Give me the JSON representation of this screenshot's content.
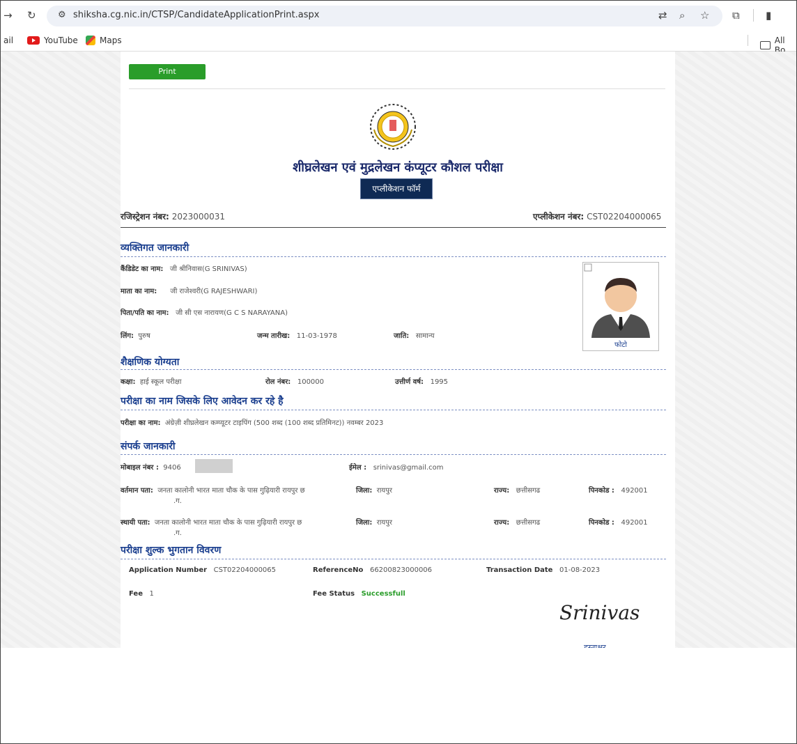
{
  "browser": {
    "url": "shiksha.cg.nic.in/CTSP/CandidateApplicationPrint.aspx",
    "bookmarks": [
      "ail",
      "YouTube",
      "Maps"
    ],
    "all_bookmarks": "All Bo"
  },
  "page": {
    "print_label": "Print",
    "title": "शीघ्रलेखन एवं मुद्रलेखन कंप्यूटर कौशल परीक्षा",
    "badge": "एप्लीकेशन फॉर्म",
    "registration_label": "रजिस्ट्रेशन नंबर:",
    "registration_value": "2023000031",
    "application_label": "एप्लीकेशन नंबर:",
    "application_value": "CST02204000065"
  },
  "personal": {
    "heading": "व्यक्तिगत जानकारी",
    "candidate_label": "कैंडिडेट का नाम:",
    "candidate_value": "जी श्रीनिवास(G SRINIVAS)",
    "mother_label": "माता का नाम:",
    "mother_value": "जी राजेश्वरी(G RAJESHWARI)",
    "father_label": "पिता/पति का नाम:",
    "father_value": "जी सी एस नारायण(G C S NARAYANA)",
    "gender_label": "लिंग:",
    "gender_value": "पुरुष",
    "dob_label": "जन्म तारीख:",
    "dob_value": "11-03-1978",
    "caste_label": "जाति:",
    "caste_value": "सामान्य",
    "photo_caption": "फोटो"
  },
  "education": {
    "heading": "शैक्षणिक योग्यता",
    "class_label": "कक्षा:",
    "class_value": "हाई स्कूल परीक्षा",
    "roll_label": "रोल नंबर:",
    "roll_value": "100000",
    "year_label": "उत्तीर्ण वर्ष:",
    "year_value": "1995"
  },
  "exam": {
    "heading": "परीक्षा का नाम जिसके लिए आवेदन कर रहे है",
    "name_label": "परीक्षा का नाम:",
    "name_value": "अंग्रेज़ी शीघ्रलेखन कम्प्यूटर टाइपिंग (500 शब्द (100 शब्द प्रतिमिनट)) नवम्बर 2023"
  },
  "contact": {
    "heading": "संपर्क जानकारी",
    "mobile_label": "मोबाइल नंबर :",
    "mobile_value": "9406",
    "email_label": "ईमेल :",
    "email_value": "srinivas@gmail.com",
    "current_label": "वर्तमान पता:",
    "current_line1": "जनता कालोनी भारत माता चौक के पास गुढ़ियारी रायपुर छ",
    "current_line2": ".ग.",
    "district_label": "जिला:",
    "district_value": "रायपुर",
    "state_label": "राज्य:",
    "state_value": "छत्तीसगढ",
    "pin_label": "पिनकोड :",
    "pin_value": "492001",
    "permanent_label": "स्थायी पता:",
    "permanent_line1": "जनता कालोनी भारत माता चौक के पास गुढ़ियारी रायपुर छ",
    "permanent_line2": ".ग.",
    "district2_value": "रायपुर",
    "state2_value": "छत्तीसगढ",
    "pin2_value": "492001"
  },
  "fee": {
    "heading": "परीक्षा शुल्क भुगतान विवरण",
    "appno_label": "Application Number",
    "appno_value": "CST02204000065",
    "ref_label": "ReferenceNo",
    "ref_value": "66200823000006",
    "txn_label": "Transaction Date",
    "txn_value": "01-08-2023",
    "fee_label": "Fee",
    "fee_value": "1",
    "status_label": "Fee Status",
    "status_value": "Successfull",
    "signature_text": "Srinivas",
    "signature_caption": "हस्ताक्षर"
  }
}
